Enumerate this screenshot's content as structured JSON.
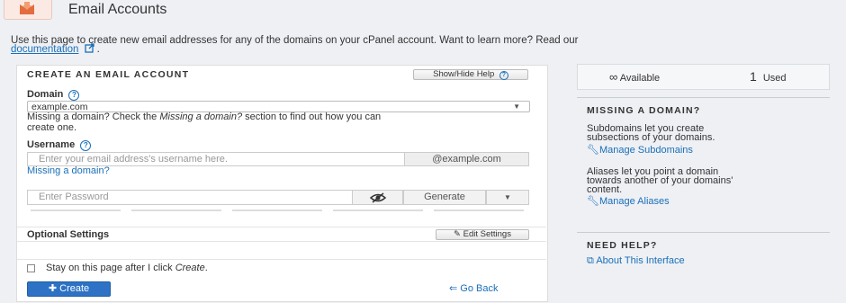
{
  "header": {
    "title": "Email Accounts"
  },
  "intro": {
    "text": "Use this page to create new email addresses for any of the domains on your cPanel account. Want to learn more? Read our",
    "link": "documentation",
    "period": "."
  },
  "form": {
    "title": "CREATE AN EMAIL ACCOUNT",
    "help_button": "Show/Hide Help",
    "domain_label": "Domain",
    "domain_value": "example.com",
    "domain_note_1": "Missing a domain? Check the ",
    "domain_note_italic": "Missing a domain?",
    "domain_note_2": " section to find out how you can",
    "domain_note_3": "create one.",
    "username_label": "Username",
    "username_placeholder": "Enter your email address's username here.",
    "username_suffix": "@example.com",
    "missing_domain_link": "Missing a domain?",
    "password_placeholder": "Enter Password",
    "generate_button": "Generate",
    "optional_settings": "Optional Settings",
    "edit_settings_button": "Edit Settings",
    "stay_label_1": "Stay on this page after I click ",
    "stay_label_italic": "Create",
    "stay_label_2": ".",
    "create_button": "Create",
    "go_back": "Go Back"
  },
  "sidebar": {
    "available_symbol": "∞",
    "available_label": "Available",
    "used_count": "1",
    "used_label": "Used",
    "missing_heading": "MISSING A DOMAIN?",
    "subdomains_text_1": "Subdomains let you create",
    "subdomains_text_2": "subsections of your domains.",
    "manage_subdomains": "Manage Subdomains",
    "aliases_text_1": "Aliases let you point a domain",
    "aliases_text_2": "towards another of your domains'",
    "aliases_text_3": "content.",
    "manage_aliases": "Manage Aliases",
    "help_heading": "NEED HELP?",
    "about_interface": "About This Interface"
  },
  "colors": {
    "accent": "#1a6fb8",
    "primary_button": "#2d72c4",
    "background": "#eef0f4"
  }
}
